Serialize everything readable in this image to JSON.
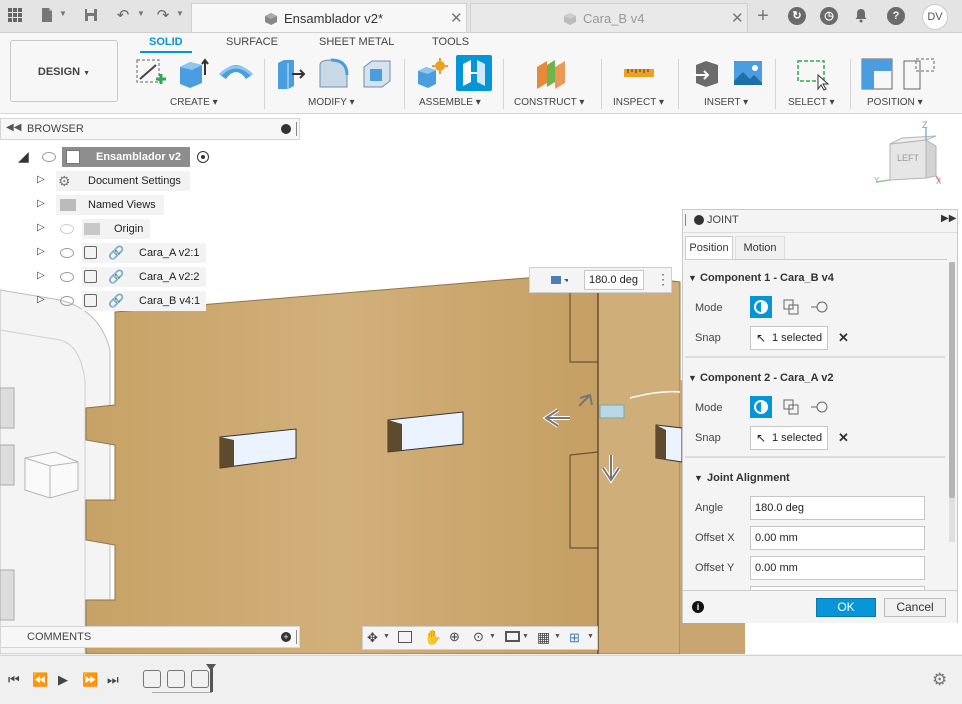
{
  "titlebar": {
    "active_tab": "Ensamblador v2*",
    "inactive_tab": "Cara_B v4",
    "user_initials": "DV"
  },
  "toolbar": {
    "design_label": "DESIGN",
    "workspace_tabs": [
      "SOLID",
      "SURFACE",
      "SHEET METAL",
      "TOOLS"
    ],
    "groups": {
      "create": "CREATE",
      "modify": "MODIFY",
      "assemble": "ASSEMBLE",
      "construct": "CONSTRUCT",
      "inspect": "INSPECT",
      "insert": "INSERT",
      "select": "SELECT",
      "position": "POSITION"
    }
  },
  "browser": {
    "title": "BROWSER",
    "root": "Ensamblador v2",
    "items": [
      {
        "label": "Document Settings"
      },
      {
        "label": "Named Views"
      },
      {
        "label": "Origin"
      },
      {
        "label": "Cara_A v2:1"
      },
      {
        "label": "Cara_A v2:2"
      },
      {
        "label": "Cara_B v4:1"
      }
    ]
  },
  "viewcube": {
    "face": "LEFT",
    "axis_z": "Z",
    "axis_y": "Y",
    "axis_x": "X"
  },
  "angle_input": {
    "value": "180.0 deg"
  },
  "joint": {
    "title": "JOINT",
    "tabs": [
      "Position",
      "Motion"
    ],
    "component1": {
      "title": "Component 1 - Cara_B v4",
      "mode_label": "Mode",
      "snap_label": "Snap",
      "snap_value": "1 selected"
    },
    "component2": {
      "title": "Component 2 - Cara_A v2",
      "mode_label": "Mode",
      "snap_label": "Snap",
      "snap_value": "1 selected"
    },
    "alignment": {
      "title": "Joint Alignment",
      "angle_label": "Angle",
      "angle_value": "180.0 deg",
      "offset_x_label": "Offset X",
      "offset_x_value": "0.00 mm",
      "offset_y_label": "Offset Y",
      "offset_y_value": "0.00 mm"
    },
    "ok_label": "OK",
    "cancel_label": "Cancel",
    "accent_color": "#0696d7"
  },
  "comments": {
    "title": "COMMENTS"
  }
}
